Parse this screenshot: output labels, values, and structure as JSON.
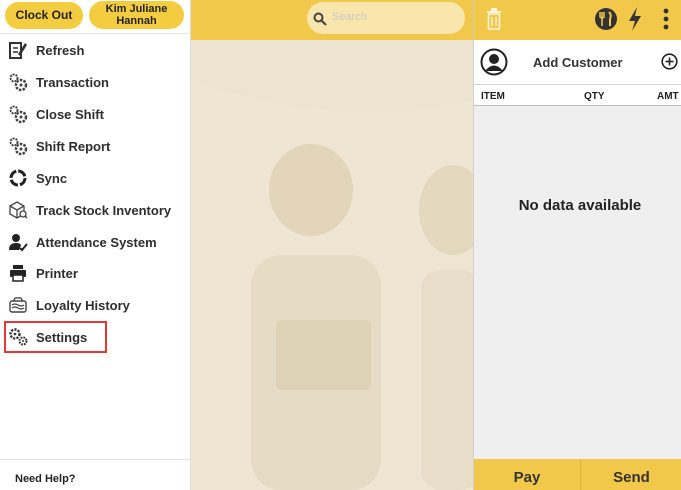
{
  "header": {
    "clock_out": "Clock Out",
    "user_name": "Kim Juliane Hannah",
    "search_placeholder": "Search"
  },
  "menu": [
    {
      "label": "Refresh",
      "icon": "refresh-notepad-icon"
    },
    {
      "label": "Transaction",
      "icon": "transaction-gears-icon"
    },
    {
      "label": "Close Shift",
      "icon": "close-shift-gears-icon"
    },
    {
      "label": "Shift Report",
      "icon": "shift-report-gears-icon"
    },
    {
      "label": "Sync",
      "icon": "sync-icon"
    },
    {
      "label": "Track Stock Inventory",
      "icon": "inventory-box-icon"
    },
    {
      "label": "Attendance System",
      "icon": "attendance-user-icon"
    },
    {
      "label": "Printer",
      "icon": "printer-icon"
    },
    {
      "label": "Loyalty History",
      "icon": "loyalty-icon"
    },
    {
      "label": "Settings",
      "icon": "settings-gears-icon"
    }
  ],
  "footer": {
    "help": "Need Help?"
  },
  "cart": {
    "add_customer": "Add Customer",
    "col_item": "ITEM",
    "col_qty": "QTY",
    "col_amt": "AMT",
    "empty_text": "No data available",
    "pay": "Pay",
    "send": "Send"
  },
  "colors": {
    "accent": "#f2c84a",
    "highlight": "#e53935"
  }
}
